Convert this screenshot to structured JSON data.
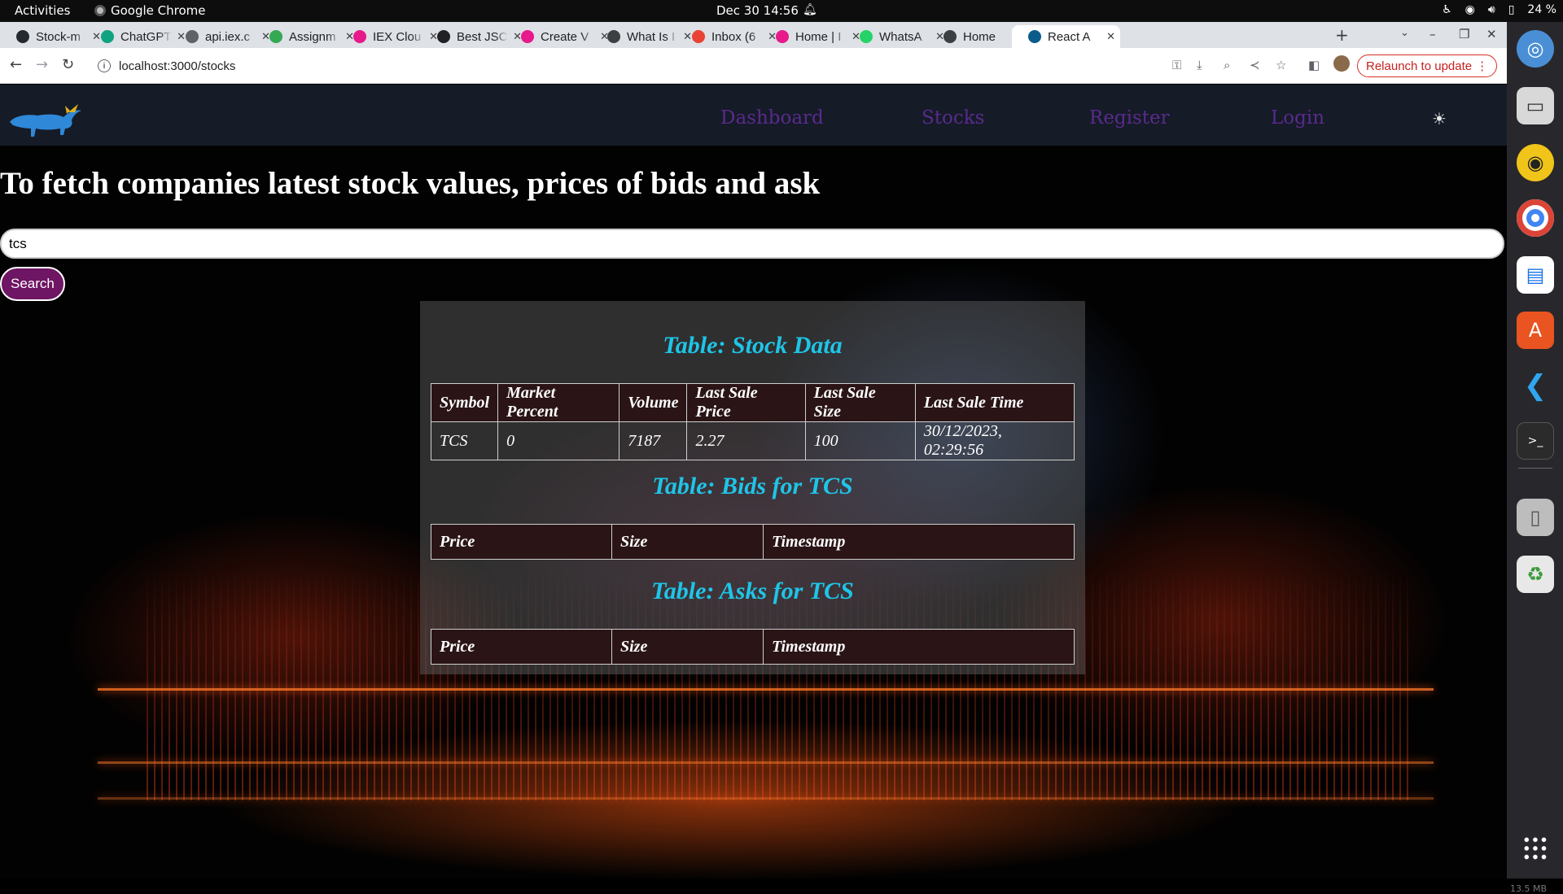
{
  "topbar": {
    "activities": "Activities",
    "app_name": "Google Chrome",
    "clock": "Dec 30  14:56",
    "battery": "24 %"
  },
  "tabs": [
    {
      "label": "Stock-m",
      "icon": "github-icon",
      "color": "#24292f"
    },
    {
      "label": "ChatGPT",
      "icon": "chatgpt-icon",
      "color": "#10a37f"
    },
    {
      "label": "api.iex.c",
      "icon": "globe-icon",
      "color": "#5f6368"
    },
    {
      "label": "Assignm",
      "icon": "assignment-icon",
      "color": "#34a853"
    },
    {
      "label": "IEX Clou",
      "icon": "iex-icon",
      "color": "#e8198b"
    },
    {
      "label": "Best JSC",
      "icon": "cb-icon",
      "color": "#202124"
    },
    {
      "label": "Create V",
      "icon": "iex-icon",
      "color": "#e8198b"
    },
    {
      "label": "What Is I",
      "icon": "whatis-icon",
      "color": "#3c4043"
    },
    {
      "label": "Inbox (6",
      "icon": "gmail-icon",
      "color": "#ea4335"
    },
    {
      "label": "Home | I",
      "icon": "iex-icon",
      "color": "#e8198b"
    },
    {
      "label": "WhatsA",
      "icon": "whatsapp-icon",
      "color": "#25d366"
    },
    {
      "label": "Home",
      "icon": "bull-icon",
      "color": "#3c4043"
    },
    {
      "label": "React A",
      "icon": "react-icon",
      "color": "#0b5c8a",
      "active": true
    }
  ],
  "toolbar": {
    "url": "localhost:3000/stocks",
    "relaunch_label": "Relaunch to update"
  },
  "nav": {
    "links": [
      "Dashboard",
      "Stocks",
      "Register",
      "Login"
    ],
    "link_color": "#5a2a8e"
  },
  "main": {
    "heading": "To fetch companies latest stock values, prices of bids and ask",
    "search_value": "tcs",
    "search_button": "Search"
  },
  "stock_table": {
    "caption": "Table: Stock Data",
    "headers": [
      "Symbol",
      "Market Percent",
      "Volume",
      "Last Sale Price",
      "Last Sale Size",
      "Last Sale Time"
    ],
    "rows": [
      [
        "TCS",
        "0",
        "7187",
        "2.27",
        "100",
        "30/12/2023, 02:29:56"
      ]
    ]
  },
  "bids_table": {
    "caption": "Table: Bids for TCS",
    "headers": [
      "Price",
      "Size",
      "Timestamp"
    ]
  },
  "asks_table": {
    "caption": "Table: Asks for TCS",
    "headers": [
      "Price",
      "Size",
      "Timestamp"
    ]
  },
  "dock": {
    "items": [
      "chrome-remote-icon",
      "files-icon",
      "rhythmbox-icon",
      "chrome-icon",
      "writer-icon",
      "software-icon",
      "vscode-icon",
      "terminal-icon",
      "drive-icon",
      "trash-icon"
    ],
    "memory": "13.5 MB"
  },
  "colors": {
    "caption": "#1ec5e8",
    "search_button_bg": "#6e1563",
    "navbar_bg": "#161c28"
  }
}
